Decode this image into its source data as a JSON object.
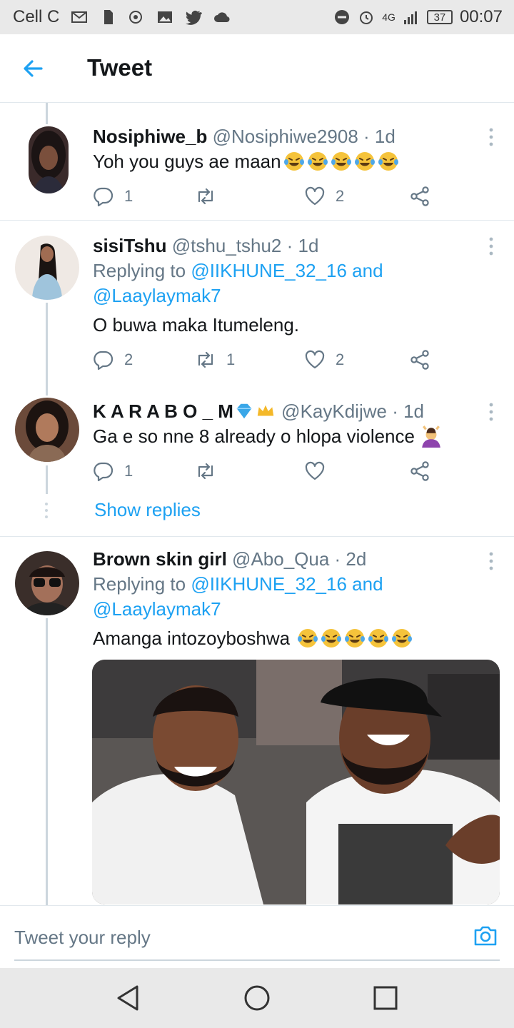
{
  "status_bar": {
    "carrier": "Cell C",
    "network": "4G",
    "battery": "37",
    "time": "00:07"
  },
  "header": {
    "title": "Tweet"
  },
  "tweets": [
    {
      "name": "Nosiphiwe_b",
      "handle": "@Nosiphiwe2908",
      "time": "· 1d",
      "text": "Yoh you guys ae maan",
      "emoji_count": 5,
      "replies": "1",
      "retweets": "",
      "likes": "2"
    },
    {
      "name": "sisiTshu",
      "handle": "@tshu_tshu2",
      "time": "· 1d",
      "replying_prefix": "Replying to ",
      "replying_user1": "@IIKHUNE_32_16",
      "replying_and": " and",
      "replying_user2": "@Laaylaymak7",
      "text": "O buwa maka Itumeleng.",
      "replies": "2",
      "retweets": "1",
      "likes": "2"
    },
    {
      "name": "K A R A B O _ M",
      "handle": "@KayKdijwe",
      "time": "· 1d",
      "text": "Ga e so nne 8 already o hlopa violence",
      "replies": "1",
      "retweets": "",
      "likes": "",
      "show_replies": "Show replies"
    },
    {
      "name": "Brown skin girl",
      "handle": "@Abo_Qua",
      "time": "· 2d",
      "replying_prefix": "Replying to ",
      "replying_user1": "@IIKHUNE_32_16",
      "replying_and": " and",
      "replying_user2": "@Laaylaymak7",
      "text": "Amanga intozoyboshwa ",
      "emoji_count": 5
    }
  ],
  "composer": {
    "placeholder": "Tweet your reply"
  },
  "colors": {
    "accent": "#1da1f2",
    "secondary_text": "#657786",
    "divider": "#e1e8ed",
    "emoji_face": "#f5c33b"
  }
}
